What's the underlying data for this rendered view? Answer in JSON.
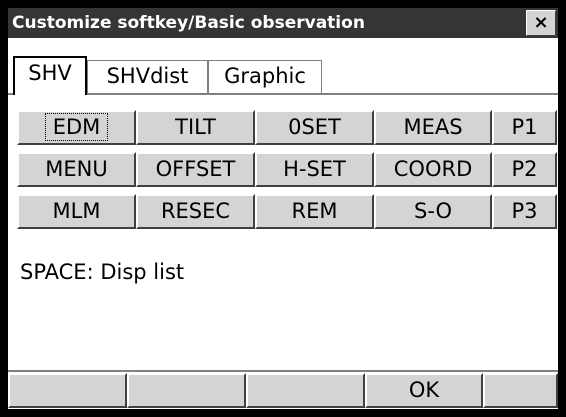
{
  "window": {
    "title": "Customize softkey/Basic observation",
    "close_label": "×"
  },
  "tabs": [
    {
      "label": "SHV",
      "active": true
    },
    {
      "label": "SHVdist",
      "active": false
    },
    {
      "label": "Graphic",
      "active": false
    }
  ],
  "keys": {
    "row1": [
      "EDM",
      "TILT",
      "0SET",
      "MEAS",
      "P1"
    ],
    "row2": [
      "MENU",
      "OFFSET",
      "H-SET",
      "COORD",
      "P2"
    ],
    "row3": [
      "MLM",
      "RESEC",
      "REM",
      "S-O",
      "P3"
    ]
  },
  "hint": "SPACE: Disp list",
  "bottom_buttons": [
    "",
    "",
    "",
    "OK",
    ""
  ]
}
